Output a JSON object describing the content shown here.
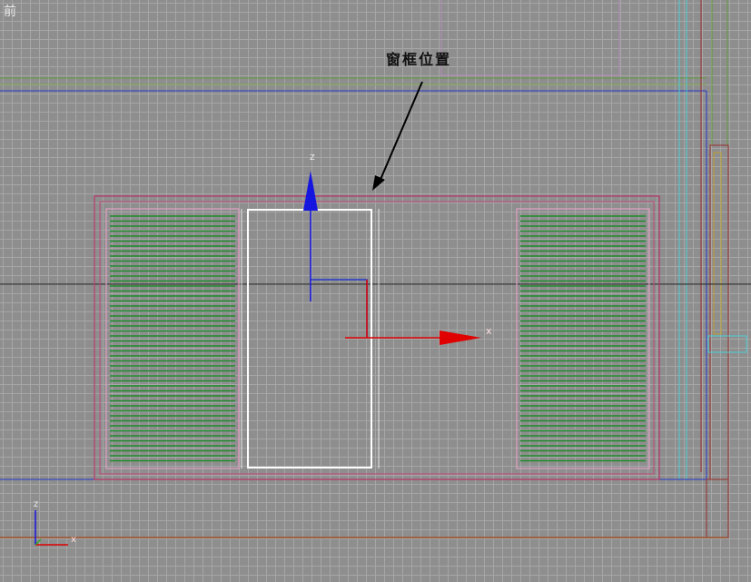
{
  "viewport": {
    "label": "前",
    "annotation": "窗框位置"
  },
  "gizmo": {
    "z_label": "z",
    "x_label": "x"
  },
  "axis_tripod": {
    "z_label": "z",
    "x_label": "x"
  },
  "colors": {
    "background": "#8e8e8e",
    "grid": "#a6a6a6",
    "frame": "#b33a6a",
    "louver": "#1f8a2c",
    "selection": "#ffffff",
    "gizmo_z": "#0000ff",
    "gizmo_x": "#e00000"
  }
}
